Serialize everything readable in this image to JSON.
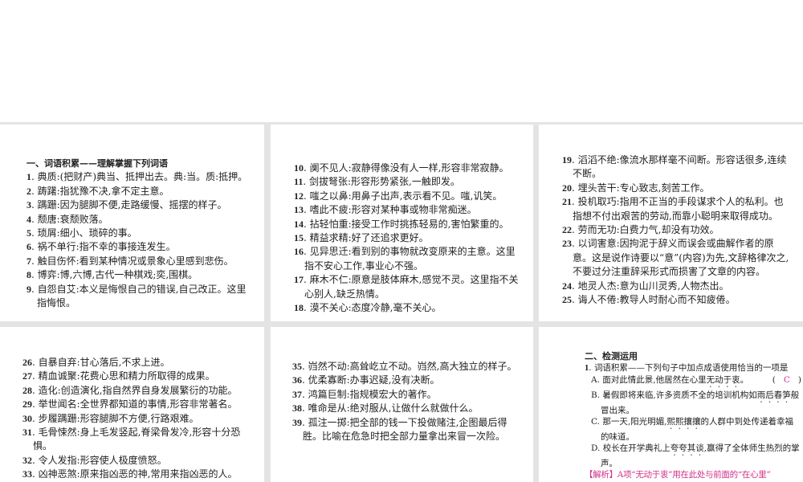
{
  "section1": {
    "heading": "一、词语积累——理解掌握下列词语"
  },
  "col1": [
    {
      "n": "1",
      "t": "典质:(把财产)典当、抵押出去。典:当。质:抵押。"
    },
    {
      "n": "2",
      "t": "踌躇:指犹豫不决,拿不定主意。"
    },
    {
      "n": "3",
      "t": "蹒跚:因为腿脚不便,走路缓慢、摇摆的样子。"
    },
    {
      "n": "4",
      "t": "颓唐:衰颓败落。"
    },
    {
      "n": "5",
      "t": "琐屑:细小、琐碎的事。"
    },
    {
      "n": "6",
      "t": "祸不单行:指不幸的事接连发生。"
    },
    {
      "n": "7",
      "t": "触目伤怀:看到某种情况或景象心里感到悲伤。"
    },
    {
      "n": "8",
      "t": "博弈:博,六博,古代一种棋戏;奕,围棋。"
    },
    {
      "n": "9",
      "t": "自怨自艾:本义是悔恨自己的错误,自己改正。这里指悔恨。"
    }
  ],
  "col2": [
    {
      "n": "10",
      "t": "阒不见人:寂静得像没有人一样,形容非常寂静。"
    },
    {
      "n": "11",
      "t": "剑拔弩张:形容形势紧张,一触即发。"
    },
    {
      "n": "12",
      "t": "嗤之以鼻:用鼻子出声,表示看不见。嗤,讥笑。"
    },
    {
      "n": "13",
      "t": "嗜此不疲:形容对某种事或物非常痴迷。"
    },
    {
      "n": "14",
      "t": "拈轻怕重:接受工作时挑拣轻易的,害怕繁重的。"
    },
    {
      "n": "15",
      "t": "精益求精:好了还追求更好。"
    },
    {
      "n": "16",
      "t": "见异思迁:看到别的事物就改变原来的主意。这里指不安心工作,事业心不强。"
    },
    {
      "n": "17",
      "t": "麻木不仁:原意是肢体麻木,感觉不灵。这里指不关心别人,缺乏热情。"
    },
    {
      "n": "18",
      "t": "漠不关心:态度冷静,毫不关心。"
    }
  ],
  "col3": [
    {
      "n": "19",
      "t": "滔滔不绝:像流水那样毫不间断。形容话很多,连续不断。"
    },
    {
      "n": "20",
      "t": "埋头苦干:专心致志,刻苦工作。"
    },
    {
      "n": "21",
      "t": "投机取巧:指用不正当的手段谋求个人的私利。也指想不付出艰苦的劳动,而靠小聪明来取得成功。"
    },
    {
      "n": "22",
      "t": "劳而无功:白费力气,却没有功效。"
    },
    {
      "n": "23",
      "t": "以词害意:因拘泥于辞义而误会或曲解作者的原意。这是说作诗要以“意”(内容)为先,文辞格律次之,不要过分注重辞采形式而损害了文章的内容。"
    },
    {
      "n": "24",
      "t": "地灵人杰:意为山川灵秀,人物杰出。"
    },
    {
      "n": "25",
      "t": "诲人不倦:教导人时耐心而不知疲倦。"
    }
  ],
  "col4": [
    {
      "n": "26",
      "t": "自暴自弃:甘心落后,不求上进。"
    },
    {
      "n": "27",
      "t": "精血诚聚:花费心思和精力所取得的成果。"
    },
    {
      "n": "28",
      "t": "造化:创造演化,指自然界自身发展繁衍的功能。"
    },
    {
      "n": "29",
      "t": "举世闻名:全世界都知道的事情,形容非常著名。"
    },
    {
      "n": "30",
      "t": "步履蹒跚:形容腿脚不方便,行路艰难。"
    },
    {
      "n": "31",
      "t": "毛骨悚然:身上毛发竖起,脊梁骨发冷,形容十分恐惧。"
    },
    {
      "n": "32",
      "t": "令人发指:形容使人极度愤怒。"
    },
    {
      "n": "33",
      "t": "凶神恶煞:原来指凶恶的神,常用来指凶恶的人。"
    }
  ],
  "col5": [
    {
      "n": "35",
      "t": "岿然不动:高耸屹立不动。岿然,高大独立的样子。"
    },
    {
      "n": "36",
      "t": "优柔寡断:办事迟疑,没有决断。"
    },
    {
      "n": "37",
      "t": "鸿篇巨制:指规模宏大的著作。"
    },
    {
      "n": "38",
      "t": "唯命是从:绝对服从,让做什么就做什么。"
    },
    {
      "n": "39",
      "t": "孤注一掷:把全部的钱一下投做赌注,企图最后得胜。比喻在危急时把全部力量拿出来冒一次险。"
    }
  ],
  "section2": {
    "heading": "二、检测运用",
    "q_num": "1",
    "q_text": "词语积累——下列句子中加点成语使用恰当的一项是",
    "answer_open": "(",
    "answer": "C",
    "answer_close": ")",
    "options": [
      {
        "pre": "A. 面对此情此景,他居然在心里",
        "em": "无动于衷",
        "post": "。"
      },
      {
        "pre": "B. 暑假即将来临,许多资质不全的培训机构如",
        "em": "雨后春笋",
        "post": "般冒出来。"
      },
      {
        "pre": "C. 那一天,阳光明媚,",
        "em": "熙熙攘攘",
        "post": "的人群中到处传递着幸福的味道。"
      },
      {
        "pre": "D. 校长在开学典礼上",
        "em": "夸夸其谈",
        "post": ",赢得了全体师生热烈的掌声。"
      }
    ],
    "analysis": "【解析】A项“无动于衷”用在此处与前面的“在心里”"
  }
}
